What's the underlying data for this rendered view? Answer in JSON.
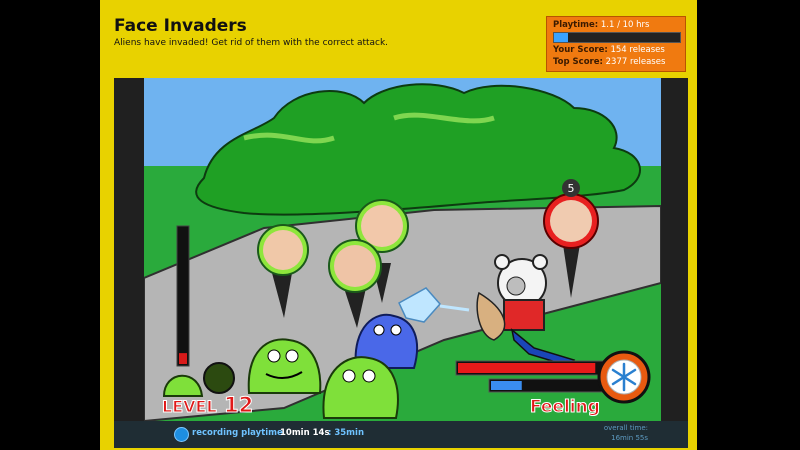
{
  "page": {
    "title": "Face Invaders",
    "subtitle": "Aliens have invaded! Get rid of them with the correct attack."
  },
  "stats": {
    "playtime_label": "Playtime:",
    "playtime_value": "1.1 / 10 hrs",
    "playtime_fraction": 0.11,
    "score_label": "Your Score:",
    "score_value": "154 releases",
    "top_label": "Top Score:",
    "top_value": "2377 releases"
  },
  "game": {
    "level_label": "LEVEL",
    "level_value": "12",
    "feeling_label": "Feeling",
    "target_count": "5",
    "health_fraction": 0.88,
    "energy_fraction": 0.25,
    "level_meter_fraction": 0.08,
    "attack_icon": "snowflake-icon",
    "colors": {
      "sky": "#6fb3f0",
      "grass": "#2aaa3c",
      "road": "#b3b3b3",
      "bush": "#1fa024",
      "alien_green": "#7fe03a",
      "alien_blue": "#4a68e8",
      "health": "#e81a1a",
      "energy": "#3a8df0"
    }
  },
  "footer": {
    "recording_label": "recording playtime",
    "session_time": "10min 14s",
    "added_time": ": 35min",
    "overall_label": "overall time:",
    "overall_value": "16min 55s"
  }
}
